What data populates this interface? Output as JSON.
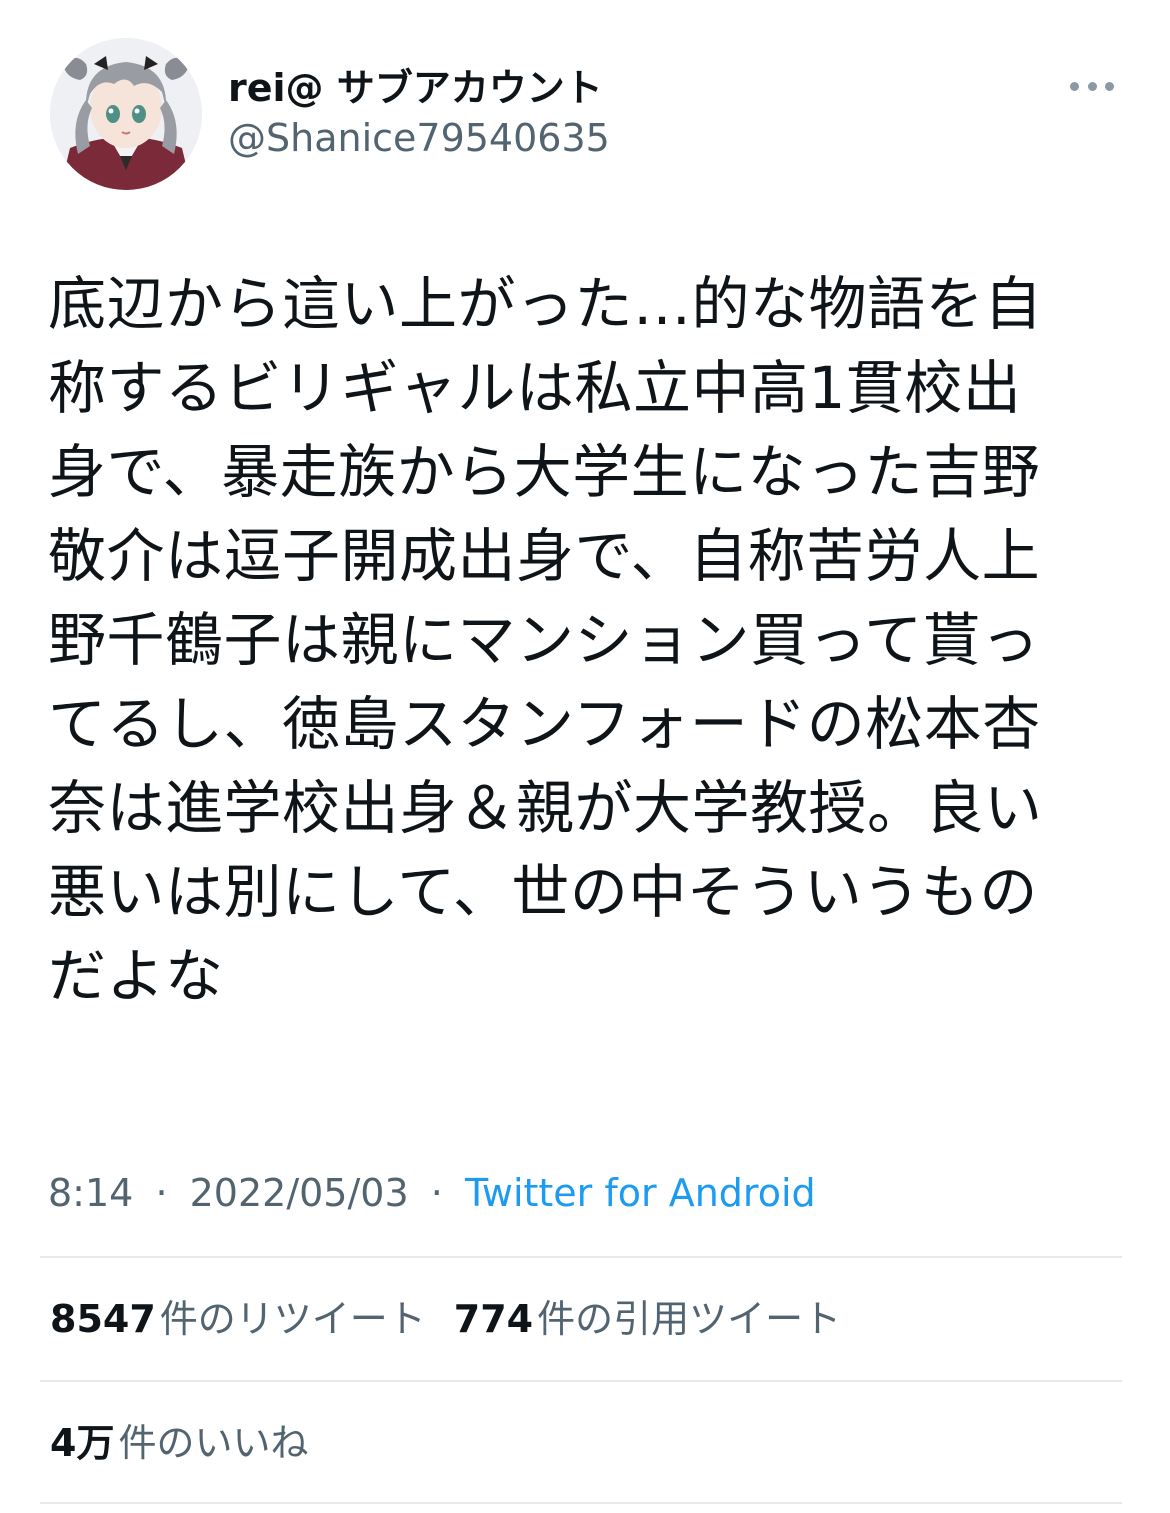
{
  "tweet": {
    "author": {
      "display_name": "rei@ サブアカウント",
      "handle": "@Shanice79540635",
      "avatar_icon": "anime-girl-avatar"
    },
    "more_icon": "more-horizontal-icon",
    "text": "底辺から這い上がった…的な物語を自\n称するビリギャルは私立中高1貫校出\n身で、暴走族から大学生になった吉野\n敬介は逗子開成出身で、自称苦労人上\n野千鶴子は親にマンション買って貰っ\nてるし、徳島スタンフォードの松本杏\n奈は進学校出身＆親が大学教授。良い\n悪いは別にして、世の中そういうもの\nだよな",
    "time": "8:14",
    "date": "2022/05/03",
    "separator": "·",
    "source": "Twitter for Android"
  },
  "stats": {
    "retweets": {
      "count": "8547",
      "label": "件のリツイート"
    },
    "quotes": {
      "count": "774",
      "label": "件の引用ツイート"
    },
    "likes": {
      "count": "4万",
      "label": "件のいいね"
    }
  },
  "colors": {
    "text": "#0f1419",
    "secondary": "#536471",
    "link": "#1d9bf0",
    "divider": "#e7e9ec"
  }
}
